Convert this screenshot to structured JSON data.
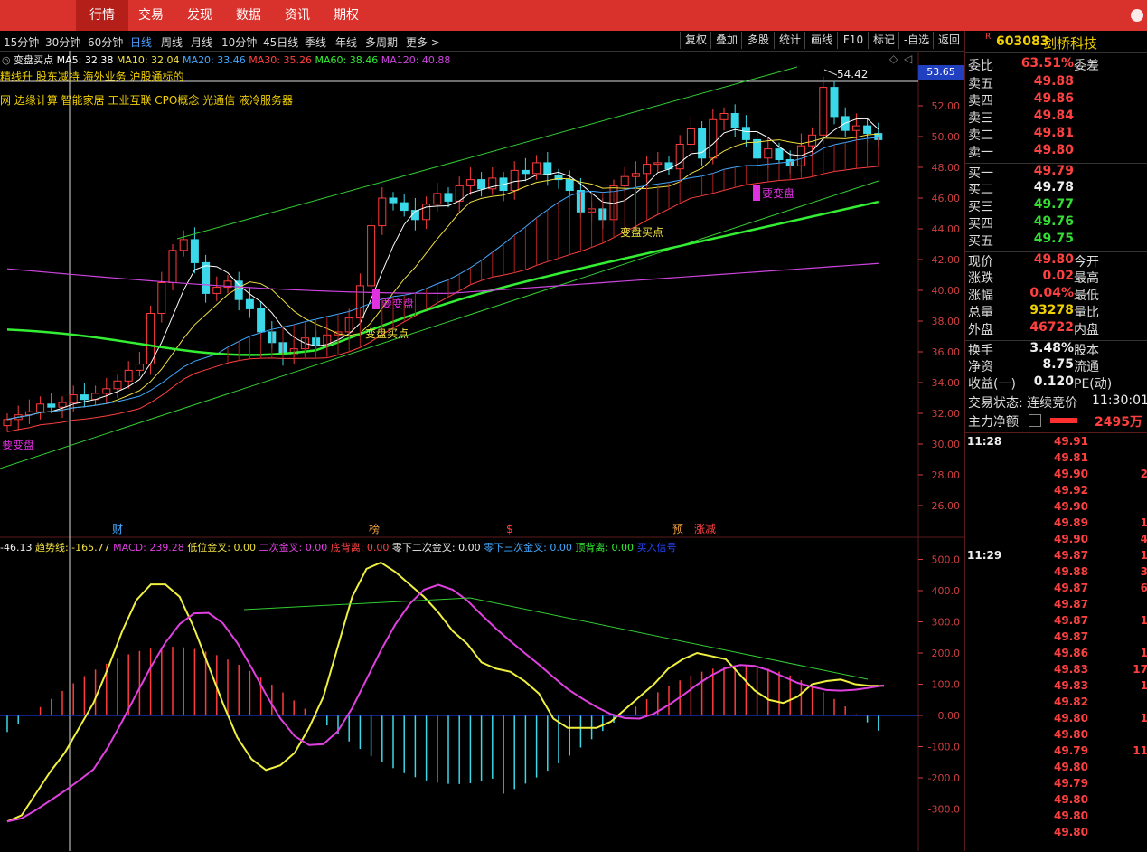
{
  "top_tabs": [
    "行情",
    "交易",
    "发现",
    "数据",
    "资讯",
    "期权"
  ],
  "periods": [
    "15分钟",
    "30分钟",
    "60分钟",
    "日线",
    "周线",
    "月线",
    "10分钟",
    "45日线",
    "季线",
    "年线",
    "多周期",
    "更多 >"
  ],
  "tools": [
    "复权",
    "叠加",
    "多股",
    "统计",
    "画线",
    "F10",
    "标记",
    "-自选",
    "返回"
  ],
  "ma_legend": {
    "title": "变盘买点",
    "ma5": "MA5: 32.38",
    "ma10": "MA10: 32.04",
    "ma20": "MA20: 33.46",
    "ma30": "MA30: 35.26",
    "ma60": "MA60: 38.46",
    "ma120": "MA120: 40.88"
  },
  "concepts_line1": "精线升 股东减持 海外业务 沪股通标的",
  "concepts_line2": "网 边缘计算 智能家居 工业互联 CPO概念 光通信 液冷服务器",
  "price_axis": [
    "52.00",
    "50.00",
    "48.00",
    "46.00",
    "44.00",
    "42.00",
    "40.00",
    "38.00",
    "36.00",
    "34.00",
    "32.00",
    "30.00",
    "28.00",
    "26.00"
  ],
  "price_current": "53.65",
  "high_mark": "54.42",
  "annotations": {
    "buy1": "变盘买点",
    "buy2": "变盘买点",
    "warn1": "要变盘",
    "warn2": "要变盘",
    "warn3": "要变盘"
  },
  "event_markers": [
    "财",
    "榜",
    "$",
    "预",
    "涨",
    "减"
  ],
  "macd_legend": {
    "v0": "-46.13",
    "trend": "趋势线: -165.77",
    "macd": "MACD: 239.28",
    "low": "低位金叉: 0.00",
    "second": "二次金叉: 0.00",
    "bottom": "底背离: 0.00",
    "zero2": "零下二次金叉: 0.00",
    "zero3": "零下三次金叉: 0.00",
    "top": "顶背离: 0.00",
    "signal": "买入信号"
  },
  "macd_axis": [
    "500.0",
    "400.0",
    "300.0",
    "200.0",
    "100.0",
    "0.00",
    "-100.0",
    "-200.0",
    "-300.0"
  ],
  "stock": {
    "code_prefix": "R",
    "code": "603083",
    "name": "剑桥科技"
  },
  "quote": {
    "weibi_label": "委比",
    "weibi": "63.51%",
    "weicha_label": "委差",
    "asks": [
      {
        "l": "卖五",
        "p": "49.88"
      },
      {
        "l": "卖四",
        "p": "49.86"
      },
      {
        "l": "卖三",
        "p": "49.84"
      },
      {
        "l": "卖二",
        "p": "49.81"
      },
      {
        "l": "卖一",
        "p": "49.80"
      }
    ],
    "bids": [
      {
        "l": "买一",
        "p": "49.79"
      },
      {
        "l": "买二",
        "p": "49.78"
      },
      {
        "l": "买三",
        "p": "49.77"
      },
      {
        "l": "买四",
        "p": "49.76"
      },
      {
        "l": "买五",
        "p": "49.75"
      }
    ],
    "stats": [
      {
        "l": "现价",
        "v": "49.80",
        "c": "red",
        "l2": "今开"
      },
      {
        "l": "涨跌",
        "v": "0.02",
        "c": "red",
        "l2": "最高"
      },
      {
        "l": "涨幅",
        "v": "0.04%",
        "c": "red",
        "l2": "最低"
      },
      {
        "l": "总量",
        "v": "93278",
        "c": "yellow",
        "l2": "量比"
      },
      {
        "l": "外盘",
        "v": "46722",
        "c": "red",
        "l2": "内盘"
      }
    ],
    "stats2": [
      {
        "l": "换手",
        "v": "3.48%",
        "l2": "股本"
      },
      {
        "l": "净资",
        "v": "8.75",
        "l2": "流通"
      },
      {
        "l": "收益(一)",
        "v": "0.120",
        "l2": "PE(动)"
      }
    ],
    "status_label": "交易状态: 连续竞价",
    "status_time": "11:30:01",
    "net_label": "主力净额",
    "net_value": "2495万"
  },
  "ticks": [
    {
      "t": "11:28",
      "p": "49.91",
      "v": ""
    },
    {
      "t": "",
      "p": "49.81",
      "v": ""
    },
    {
      "t": "",
      "p": "49.90",
      "v": "2"
    },
    {
      "t": "",
      "p": "49.92",
      "v": ""
    },
    {
      "t": "",
      "p": "49.90",
      "v": ""
    },
    {
      "t": "",
      "p": "49.89",
      "v": "1"
    },
    {
      "t": "",
      "p": "49.90",
      "v": "4"
    },
    {
      "t": "11:29",
      "p": "49.87",
      "v": "1"
    },
    {
      "t": "",
      "p": "49.88",
      "v": "3"
    },
    {
      "t": "",
      "p": "49.87",
      "v": "6"
    },
    {
      "t": "",
      "p": "49.87",
      "v": ""
    },
    {
      "t": "",
      "p": "49.87",
      "v": "1"
    },
    {
      "t": "",
      "p": "49.87",
      "v": ""
    },
    {
      "t": "",
      "p": "49.86",
      "v": "1"
    },
    {
      "t": "",
      "p": "49.83",
      "v": "17"
    },
    {
      "t": "",
      "p": "49.83",
      "v": "1"
    },
    {
      "t": "",
      "p": "49.82",
      "v": ""
    },
    {
      "t": "",
      "p": "49.80",
      "v": "1"
    },
    {
      "t": "",
      "p": "49.80",
      "v": ""
    },
    {
      "t": "",
      "p": "49.79",
      "v": "11"
    },
    {
      "t": "",
      "p": "49.80",
      "v": ""
    },
    {
      "t": "",
      "p": "49.79",
      "v": ""
    },
    {
      "t": "",
      "p": "49.80",
      "v": ""
    },
    {
      "t": "",
      "p": "49.80",
      "v": ""
    },
    {
      "t": "",
      "p": "49.80",
      "v": ""
    }
  ],
  "colors": {
    "up": "#ff3b3b",
    "down": "#3ad8e8",
    "ma5": "#ffffff",
    "ma10": "#f0e040",
    "ma20": "#40a8ff",
    "ma30": "#ff4040",
    "ma60": "#33ee33",
    "ma120": "#cc44dd"
  }
}
